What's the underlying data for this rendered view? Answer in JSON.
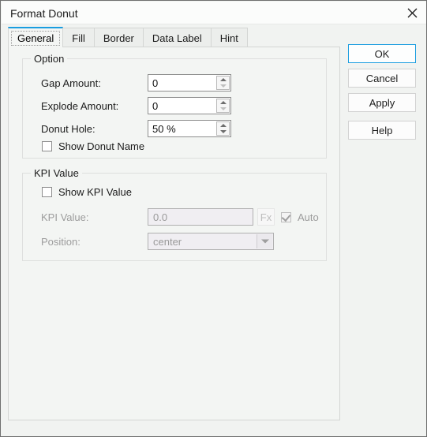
{
  "window": {
    "title": "Format Donut",
    "close_icon": "close-icon"
  },
  "tabs": [
    {
      "label": "General",
      "active": true
    },
    {
      "label": "Fill",
      "active": false
    },
    {
      "label": "Border",
      "active": false
    },
    {
      "label": "Data Label",
      "active": false
    },
    {
      "label": "Hint",
      "active": false
    }
  ],
  "option_group": {
    "title": "Option",
    "gap_amount": {
      "label": "Gap Amount:",
      "value": "0"
    },
    "explode_amount": {
      "label": "Explode Amount:",
      "value": "0"
    },
    "donut_hole": {
      "label": "Donut Hole:",
      "value": "50 %"
    },
    "show_donut_name": {
      "label": "Show Donut Name",
      "checked": false
    }
  },
  "kpi_group": {
    "title": "KPI Value",
    "show_kpi_value": {
      "label": "Show KPI Value",
      "checked": false
    },
    "kpi_value": {
      "label": "KPI Value:",
      "value": "0.0"
    },
    "fx_button": {
      "label": "Fx"
    },
    "auto": {
      "label": "Auto",
      "checked": true
    },
    "position": {
      "label": "Position:",
      "value": "center"
    }
  },
  "buttons": {
    "ok": "OK",
    "cancel": "Cancel",
    "apply": "Apply",
    "help": "Help"
  },
  "colors": {
    "accent": "#1a9de0",
    "dialog_bg": "#f1f3f1",
    "panel_bg": "#f3f5f3",
    "disabled_text": "#9a9a9a"
  }
}
